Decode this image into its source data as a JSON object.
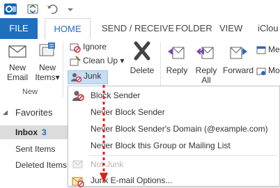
{
  "window": {
    "app_icon": "outlook-icon",
    "quick_access": [
      "send-receive-icon",
      "undo-icon",
      "dropdown-icon"
    ]
  },
  "tabs": [
    {
      "label": "FILE"
    },
    {
      "label": "HOME"
    },
    {
      "label": "SEND / RECEIVE"
    },
    {
      "label": "FOLDER"
    },
    {
      "label": "VIEW"
    },
    {
      "label": "iClou"
    }
  ],
  "ribbon": {
    "new_group": {
      "new_email_line1": "New",
      "new_email_line2": "Email",
      "new_items_line1": "New",
      "new_items_line2": "Items",
      "new_items_arrow": "▾",
      "label": "New"
    },
    "delete_group": {
      "ignore": "Ignore",
      "clean_up": "Clean Up",
      "clean_up_arrow": "▾",
      "junk": "Junk",
      "junk_arrow": "▾",
      "delete": "Delete"
    },
    "respond_group": {
      "reply": "Reply",
      "reply_all_line1": "Reply",
      "reply_all_line2": "All",
      "forward": "Forward",
      "meeting_partial": "Me",
      "more_partial": "Mo"
    }
  },
  "nav": {
    "favorites": "Favorites",
    "collapse_arrow": "◢",
    "inbox": "Inbox",
    "inbox_count": "3",
    "sent": "Sent Items",
    "deleted": "Deleted Items"
  },
  "junk_menu": {
    "items": [
      {
        "label": "Block Sender",
        "enabled": true,
        "icon": "block-sender-icon"
      },
      {
        "label": "Never Block Sender",
        "enabled": true,
        "icon": ""
      },
      {
        "label": "Never Block Sender's Domain (@example.com)",
        "enabled": true,
        "icon": ""
      },
      {
        "label": "Never Block this Group or Mailing List",
        "enabled": true,
        "icon": ""
      },
      {
        "label": "Not Junk",
        "enabled": false,
        "icon": "not-junk-icon"
      },
      {
        "label": "Junk E-mail Options...",
        "enabled": true,
        "icon": "junk-options-icon"
      }
    ]
  },
  "colors": {
    "accent": "#1e6fbf",
    "annotation_arrow": "#e02020"
  }
}
